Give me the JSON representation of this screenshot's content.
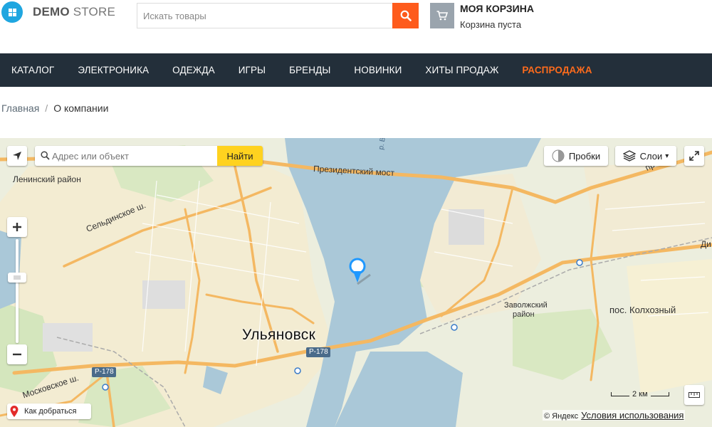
{
  "header": {
    "logo_bold": "DEMO",
    "logo_light": " STORE",
    "search_placeholder": "Искать товары",
    "cart_title": "МОЯ КОРЗИНА",
    "cart_status": "Корзина пуста"
  },
  "nav": {
    "items": [
      "КАТАЛОГ",
      "ЭЛЕКТРОНИКА",
      "ОДЕЖДА",
      "ИГРЫ",
      "БРЕНДЫ",
      "НОВИНКИ",
      "ХИТЫ ПРОДАЖ",
      "РАСПРОДАЖА"
    ]
  },
  "breadcrumb": {
    "home": "Главная",
    "separator": "/",
    "current": "О компании"
  },
  "map": {
    "search_placeholder": "Адрес или объект",
    "search_button": "Найти",
    "traffic_label": "Пробки",
    "layers_label": "Слои",
    "labels": {
      "city": "Ульяновск",
      "bridge": "Президентский мост",
      "district_lenin": "Ленинский район",
      "district_zavolzh_1": "Заволжский",
      "district_zavolzh_2": "район",
      "kolkhozny": "пос. Колхозный",
      "street_seld": "Сельдинское ш.",
      "street_moskov": "Московское ш.",
      "road_1": "Р-178",
      "road_2": "Р-178",
      "prosp": "просп",
      "di": "Ди",
      "river": "р. В"
    },
    "route_label": "Как добраться",
    "scale_label": "2 км",
    "copyright": "© Яндекс",
    "terms": "Условия использования"
  },
  "colors": {
    "nav_bg": "#232f3a",
    "accent": "#fe5b1c",
    "sale": "#fe6b1c",
    "water": "#aac8d8",
    "road": "#f4b862",
    "map_yellow": "#ffd21f"
  }
}
